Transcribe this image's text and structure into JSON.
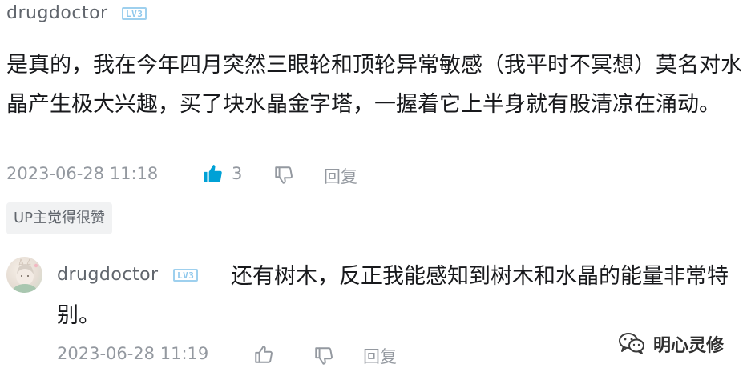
{
  "comment": {
    "username": "drugdoctor",
    "level_badge": "LV3",
    "text": "是真的，我在今年四月突然三眼轮和顶轮异常敏感（我平时不冥想）莫名对水晶产生极大兴趣，买了块水晶金字塔，一握着它上半身就有股清凉在涌动。",
    "timestamp": "2023-06-28 11:18",
    "like_count": "3",
    "reply_label": "回复",
    "up_tag": "UP主觉得很赞",
    "liked": true
  },
  "reply": {
    "username": "drugdoctor",
    "level_badge": "LV3",
    "text": "还有树木，反正我能感知到树木和水晶的能量非常特别。",
    "timestamp": "2023-06-28 11:19",
    "reply_label": "回复"
  },
  "watermark": {
    "label": "明心灵修"
  },
  "colors": {
    "like_active": "#00a1d6",
    "meta_gray": "#9499a0",
    "badge": "#8fc8ec"
  }
}
